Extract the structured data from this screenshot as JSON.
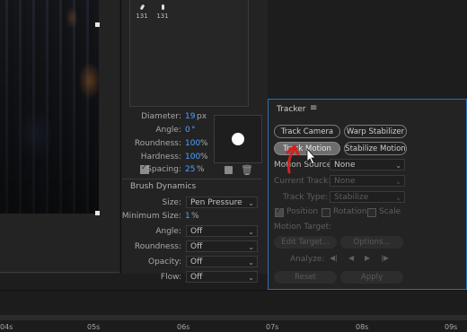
{
  "brushes": {
    "thumbs": [
      "131",
      "131"
    ]
  },
  "brush_settings": {
    "diameter": {
      "label": "Diameter:",
      "value": "19",
      "unit": "px"
    },
    "angle": {
      "label": "Angle:",
      "value": "0",
      "unit": "°"
    },
    "roundness": {
      "label": "Roundness:",
      "value": "100",
      "unit": "%"
    },
    "hardness": {
      "label": "Hardness:",
      "value": "100",
      "unit": "%"
    },
    "spacing": {
      "label": "Spacing:",
      "value": "25",
      "unit": "%",
      "checked": true
    }
  },
  "brush_dynamics": {
    "title": "Brush Dynamics",
    "size": {
      "label": "Size:",
      "value": "Pen Pressure"
    },
    "min_size": {
      "label": "Minimum Size:",
      "value": "1",
      "unit": "%"
    },
    "angle": {
      "label": "Angle:",
      "value": "Off"
    },
    "roundness": {
      "label": "Roundness:",
      "value": "Off"
    },
    "opacity": {
      "label": "Opacity:",
      "value": "Off"
    },
    "flow": {
      "label": "Flow:",
      "value": "Off"
    }
  },
  "tracker": {
    "title": "Tracker",
    "menu_icon": "hamburger-icon",
    "track_camera": "Track Camera",
    "warp_stabilizer": "Warp Stabilizer",
    "track_motion": "Track Motion",
    "stabilize_motion": "Stabilize Motion",
    "motion_source_label": "Motion Source:",
    "motion_source_value": "None",
    "current_track_label": "Current Track:",
    "current_track_value": "None",
    "track_type_label": "Track Type:",
    "track_type_value": "Stabilize",
    "position": "Position",
    "rotation": "Rotation",
    "scale": "Scale",
    "motion_target_label": "Motion Target:",
    "edit_target": "Edit Target...",
    "options": "Options...",
    "analyze_label": "Analyze:",
    "reset": "Reset",
    "apply": "Apply"
  },
  "timeline": {
    "ticks": [
      "04s",
      "05s",
      "06s",
      "07s",
      "08s",
      "09s"
    ]
  },
  "colors": {
    "accent": "#4fa0ff",
    "panel_border": "#2b6fb4",
    "annotation": "#d42020"
  }
}
